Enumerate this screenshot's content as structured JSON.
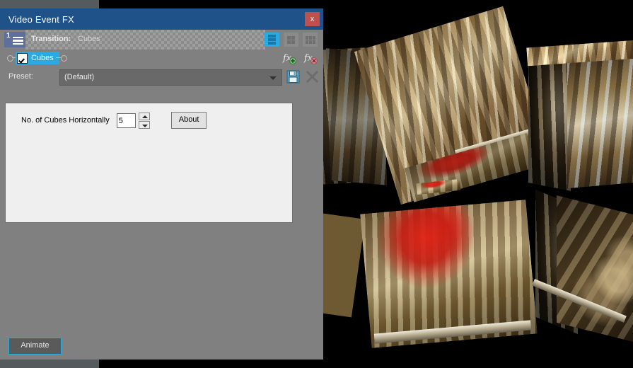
{
  "window": {
    "title": "Video Event FX",
    "close_label": "x"
  },
  "fx_header": {
    "chain_index": "1",
    "label": "Transition:",
    "value": "Cubes",
    "view_buttons": [
      {
        "name": "single-column-view",
        "icon": "list-view-icon",
        "active": true
      },
      {
        "name": "two-column-view",
        "icon": "grid-2x2-icon",
        "active": false
      },
      {
        "name": "three-column-view",
        "icon": "grid-3x2-icon",
        "active": false
      }
    ]
  },
  "plugin_chain": {
    "enabled": true,
    "plugin_name": "Cubes",
    "add_icon": "fx-add-icon",
    "remove_icon": "fx-remove-icon"
  },
  "preset": {
    "label": "Preset:",
    "value": "(Default)",
    "options": [
      "(Default)"
    ],
    "save_icon": "floppy-save-icon",
    "delete_icon": "delete-x-icon"
  },
  "parameters": {
    "cubes_horizontally": {
      "label": "No. of Cubes Horizontally",
      "value": "5"
    },
    "about_label": "About"
  },
  "footer": {
    "animate_label": "Animate"
  },
  "colors": {
    "titlebar": "#1e5288",
    "accent": "#29abe2",
    "close": "#c0504d",
    "dialog_bg": "#808080",
    "panel_bg": "#efefef"
  },
  "preview": {
    "description": "3D cube transition preview over black background showing cave photographs"
  }
}
